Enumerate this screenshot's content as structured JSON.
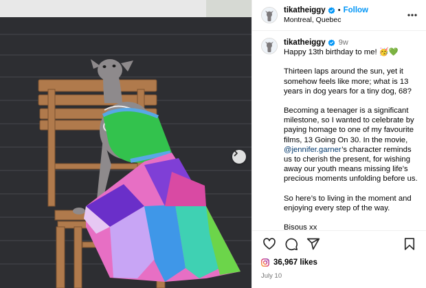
{
  "post": {
    "username": "tikatheiggy",
    "follow_label": "Follow",
    "separator": "•",
    "location": "Montreal, Quebec",
    "caption": {
      "time_ago": "9w",
      "line1": "Happy 13th birthday to me! 🥳💚",
      "para1": "Thirteen laps around the sun, yet it somehow feels like more; what is 13 years in dog years for a tiny dog, 68?",
      "para2_before": "Becoming a teenager is a significant milestone, so I wanted to celebrate by paying homage to one of my favourite films, 13 Going On 30. In the movie, ",
      "para2_mention": "@jennifer.garner",
      "para2_after": "’s character reminds us to cherish the present, for wishing away our youth means missing life’s precious moments unfolding before us.",
      "para3": "So here’s to living in the moment and enjoying every step of the way.",
      "para4": "Bisous xx"
    },
    "likes": "36,967 likes",
    "date": "July 10"
  },
  "icons": {
    "verified": "verified-badge-icon",
    "more": "more-options-icon",
    "like": "heart-icon",
    "comment": "comment-icon",
    "share": "share-icon",
    "save": "bookmark-icon",
    "next": "chevron-right-icon"
  },
  "colors": {
    "follow_blue": "#0095f6",
    "mention_blue": "#00376b",
    "meta_gray": "#737373",
    "verified_blue": "#0095f6",
    "divider": "#efefef"
  }
}
